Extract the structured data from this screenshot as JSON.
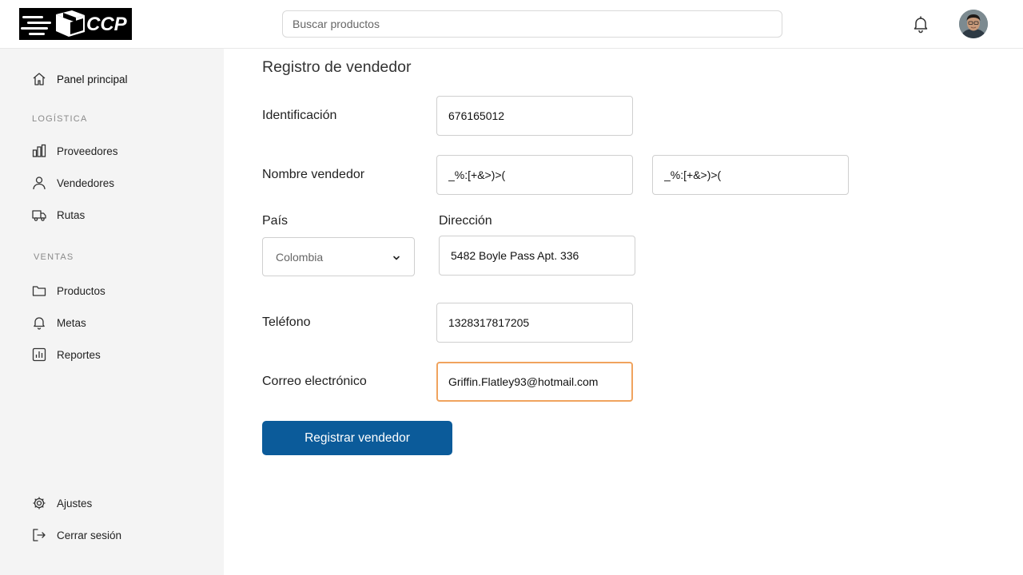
{
  "header": {
    "logo_text": "CCP",
    "search_placeholder": "Buscar productos"
  },
  "sidebar": {
    "main_item": "Panel principal",
    "sections": [
      {
        "title": "LOGÍSTICA",
        "items": [
          "Proveedores",
          "Vendedores",
          "Rutas"
        ]
      },
      {
        "title": "VENTAS",
        "items": [
          "Productos",
          "Metas",
          "Reportes"
        ]
      }
    ],
    "bottom_items": [
      "Ajustes",
      "Cerrar sesión"
    ]
  },
  "form": {
    "title": "Registro de vendedor",
    "id_label": "Identificación",
    "id_value": "676165012",
    "name_label": "Nombre vendedor",
    "first_name_value": "_%:[+&>)>(",
    "last_name_value": "_%:[+&>)>(",
    "country_label": "País",
    "country_value": "Colombia",
    "address_label": "Dirección",
    "address_value": "5482 Boyle Pass Apt. 336",
    "phone_label": "Teléfono",
    "phone_value": "1328317817205",
    "email_label": "Correo electrónico",
    "email_value": "Griffin.Flatley93@hotmail.com",
    "submit_label": "Registrar vendedor"
  },
  "colors": {
    "primary_button": "#0b5b9a",
    "focus_border": "#f0a35e",
    "sidebar_bg": "#f4f4f4"
  }
}
